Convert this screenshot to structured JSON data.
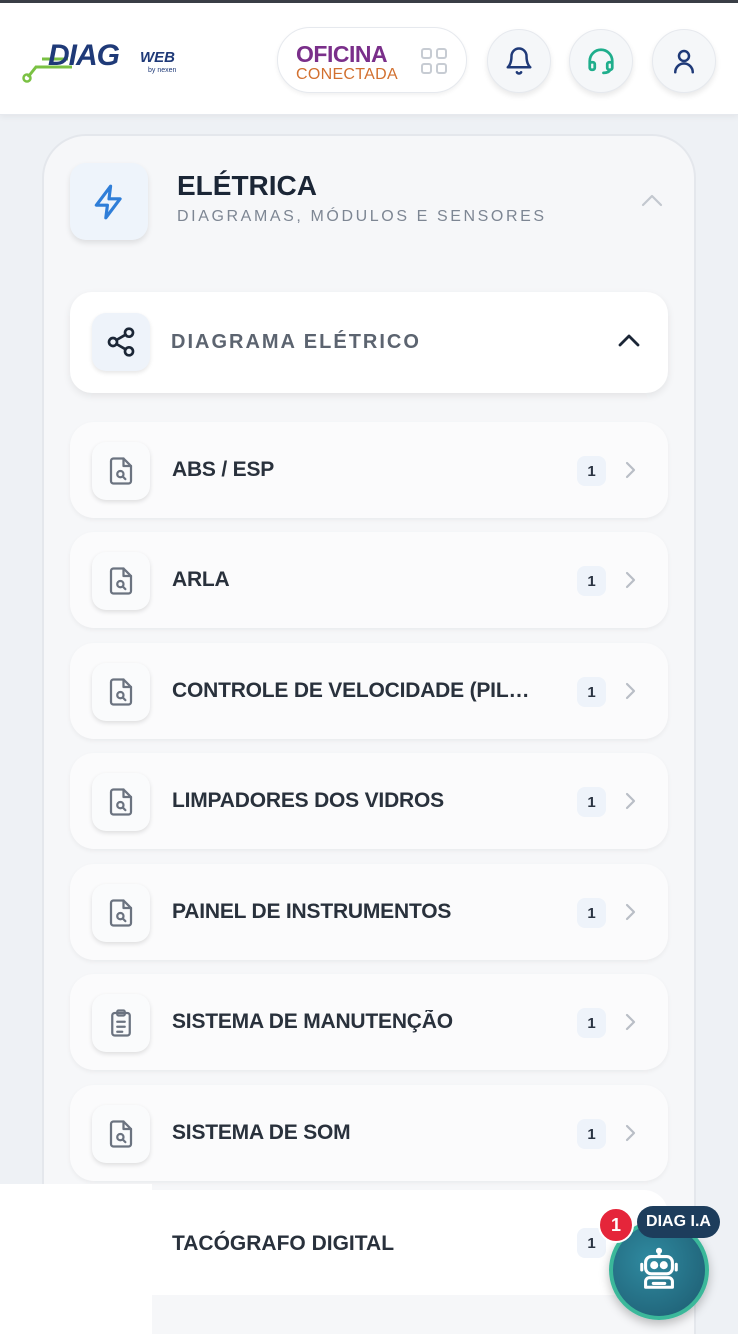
{
  "header": {
    "logo_main": "DIAG",
    "logo_suffix": "WEB",
    "logo_by": "by nexen",
    "partner_line1": "OFICINA",
    "partner_line2": "CONECTADA",
    "icons": [
      "apps-grid-icon",
      "bell-icon",
      "headset-icon",
      "user-icon"
    ]
  },
  "section": {
    "title": "ELÉTRICA",
    "subtitle": "DIAGRAMAS, MÓDULOS E SENSORES",
    "icon": "lightning-icon"
  },
  "subsection": {
    "label": "DIAGRAMA ELÉTRICO",
    "icon": "share-icon"
  },
  "items": [
    {
      "label": "ABS / ESP",
      "count": "1",
      "icon": "document-search-icon"
    },
    {
      "label": "ARLA",
      "count": "1",
      "icon": "document-search-icon"
    },
    {
      "label": "CONTROLE DE VELOCIDADE (PILOTO AUTOMÁTICO)",
      "count": "1",
      "icon": "document-search-icon"
    },
    {
      "label": "LIMPADORES DOS VIDROS",
      "count": "1",
      "icon": "document-search-icon"
    },
    {
      "label": "PAINEL DE INSTRUMENTOS",
      "count": "1",
      "icon": "document-search-icon"
    },
    {
      "label": "SISTEMA DE MANUTENÇÃO",
      "count": "1",
      "icon": "clipboard-list-icon"
    },
    {
      "label": "SISTEMA DE SOM",
      "count": "1",
      "icon": "document-search-icon"
    },
    {
      "label": "TACÓGRAFO DIGITAL",
      "count": "1",
      "icon": "document-search-icon"
    }
  ],
  "assistant": {
    "label": "DIAG I.A",
    "badge": "1",
    "icon": "robot-icon"
  },
  "colors": {
    "accent_blue": "#2f7ed8",
    "brand_navy": "#1f3a78",
    "oficina_purple": "#7a2f8a",
    "oficina_orange": "#d2702f",
    "badge_red": "#e5253a",
    "headset_green": "#1fae8c"
  }
}
